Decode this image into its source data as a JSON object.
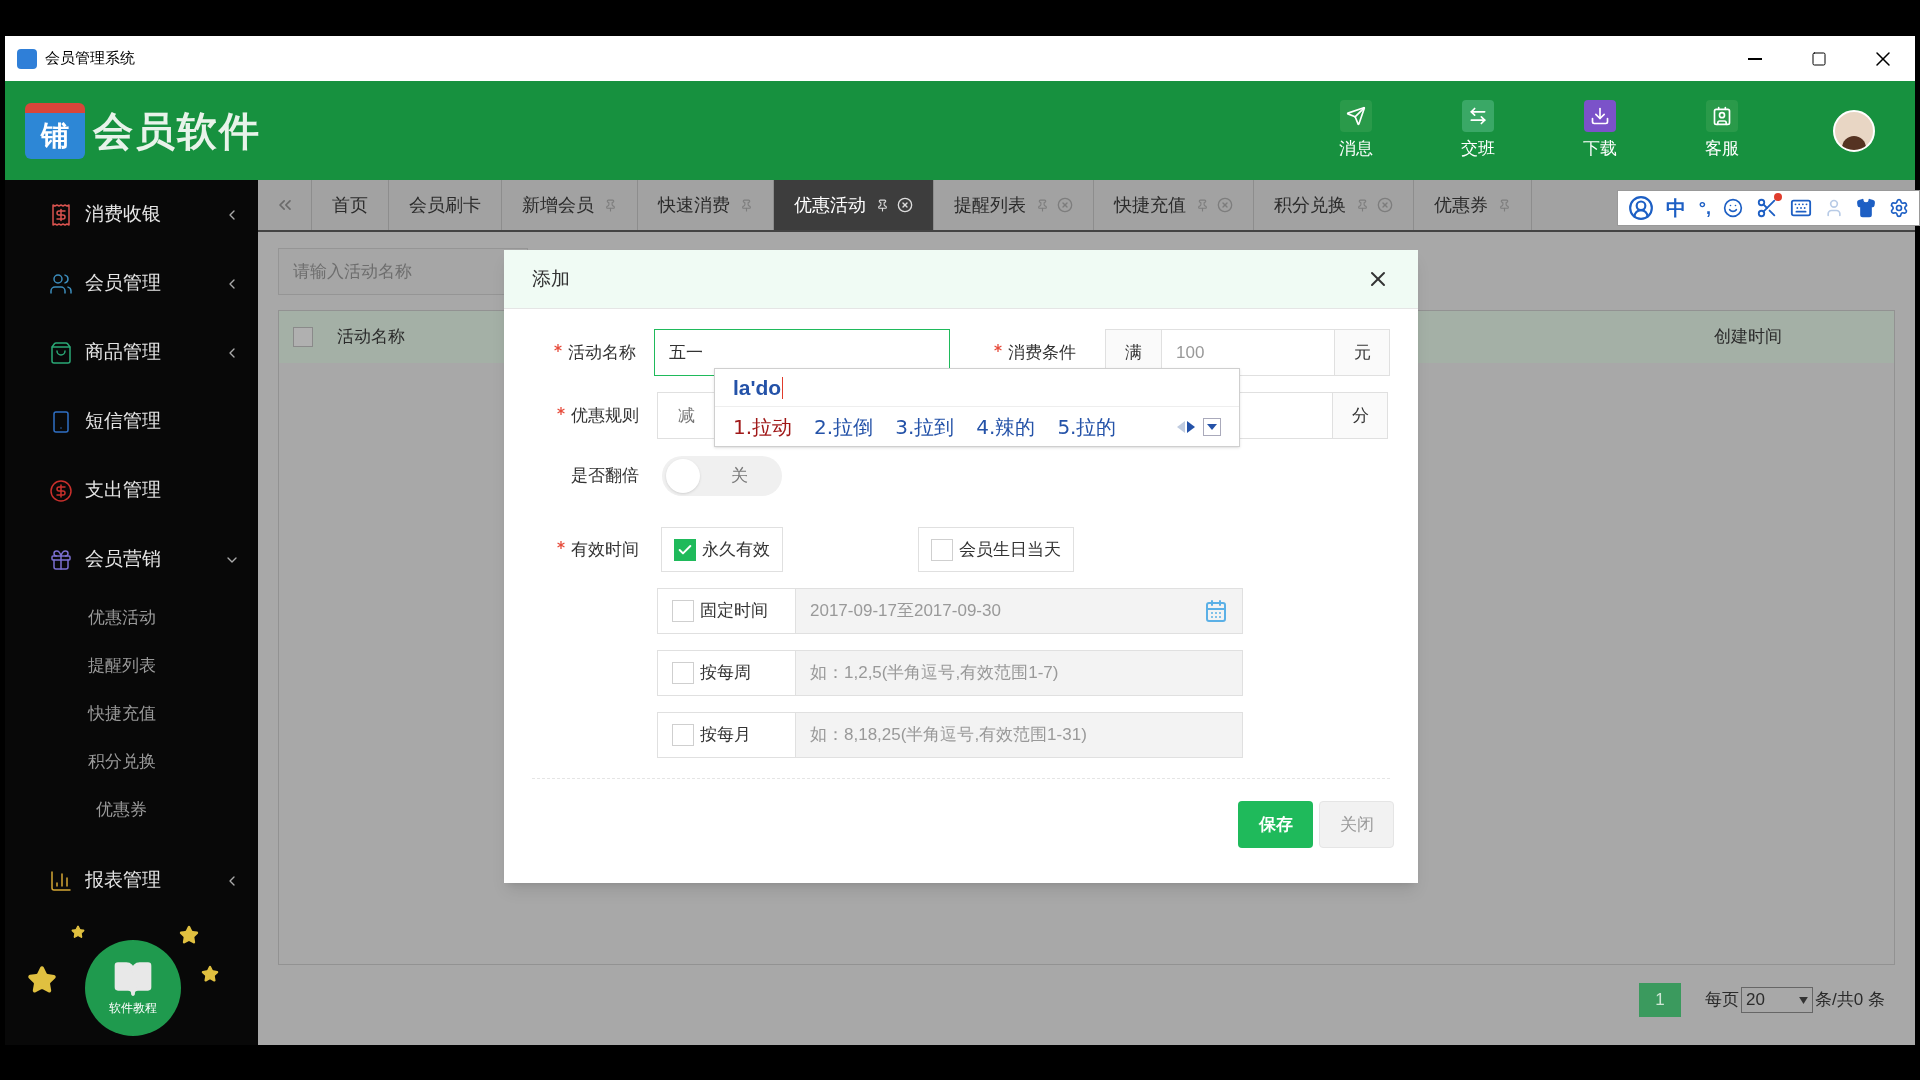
{
  "window": {
    "title": "会员管理系统"
  },
  "header": {
    "logo_badge": "铺",
    "logo_text": "会员软件",
    "actions": [
      {
        "label": "消息"
      },
      {
        "label": "交班"
      },
      {
        "label": "下载"
      },
      {
        "label": "客服"
      }
    ]
  },
  "sidebar": {
    "items": [
      {
        "label": "消费收银",
        "expanded": false
      },
      {
        "label": "会员管理",
        "expanded": false
      },
      {
        "label": "商品管理",
        "expanded": false
      },
      {
        "label": "短信管理"
      },
      {
        "label": "支出管理"
      },
      {
        "label": "会员营销",
        "expanded": true,
        "children": [
          {
            "label": "优惠活动"
          },
          {
            "label": "提醒列表"
          },
          {
            "label": "快捷充值"
          },
          {
            "label": "积分兑换"
          },
          {
            "label": "优惠券"
          }
        ]
      },
      {
        "label": "报表管理",
        "expanded": false
      }
    ],
    "tutorial": "软件教程"
  },
  "tabs": [
    {
      "label": "首页",
      "selected": false,
      "pinned": false,
      "closable": false
    },
    {
      "label": "会员刷卡",
      "selected": false,
      "pinned": false,
      "closable": false
    },
    {
      "label": "新增会员",
      "selected": false,
      "pinned": true,
      "closable": false
    },
    {
      "label": "快速消费",
      "selected": false,
      "pinned": true,
      "closable": false
    },
    {
      "label": "优惠活动",
      "selected": true,
      "pinned": true,
      "closable": true
    },
    {
      "label": "提醒列表",
      "selected": false,
      "pinned": true,
      "closable": true
    },
    {
      "label": "快捷充值",
      "selected": false,
      "pinned": true,
      "closable": true
    },
    {
      "label": "积分兑换",
      "selected": false,
      "pinned": true,
      "closable": true
    },
    {
      "label": "优惠券",
      "selected": false,
      "pinned": true,
      "closable": false
    }
  ],
  "search": {
    "placeholder": "请输入活动名称"
  },
  "table": {
    "select_all": {
      "checked": false
    },
    "columns": [
      "活动名称",
      "创建时间"
    ]
  },
  "pagination": {
    "pages": [
      {
        "label": "1",
        "selected": true
      }
    ],
    "per_page_label": "每页",
    "per_page": "20",
    "total": "条/共0 条"
  },
  "dialog": {
    "title": "添加",
    "name": {
      "label": "活动名称",
      "required": true,
      "value": "五一",
      "focused": true
    },
    "condition": {
      "label": "消费条件",
      "required": true,
      "prefix": "满",
      "placeholder": "100",
      "suffix": "元"
    },
    "rule": {
      "label": "优惠规则",
      "required": true,
      "placeholder": "减"
    },
    "rule_extra": {
      "suffix": "分"
    },
    "double": {
      "label": "是否翻倍",
      "on": false,
      "text": "关"
    },
    "validity": {
      "label": "有效时间",
      "required": true,
      "options": [
        {
          "label": "永久有效",
          "checked": true
        },
        {
          "label": "会员生日当天",
          "checked": false
        }
      ],
      "rows": [
        {
          "label": "固定时间",
          "checked": false,
          "placeholder": "2017-09-17至2017-09-30",
          "calendar": true
        },
        {
          "label": "按每周",
          "checked": false,
          "placeholder": "如：1,2,5(半角逗号,有效范围1-7)"
        },
        {
          "label": "按每月",
          "checked": false,
          "placeholder": "如：8,18,25(半角逗号,有效范围1-31)"
        }
      ]
    },
    "buttons": [
      {
        "label": "保存",
        "kind": "primary"
      },
      {
        "label": "关闭",
        "kind": "default"
      }
    ]
  },
  "ime": {
    "composition": "la'do",
    "candidates": [
      {
        "label": "1.拉动",
        "selected": true
      },
      {
        "label": "2.拉倒",
        "selected": false
      },
      {
        "label": "3.拉到",
        "selected": false
      },
      {
        "label": "4.辣的",
        "selected": false
      },
      {
        "label": "5.拉的",
        "selected": false
      }
    ]
  },
  "ime_toolbar": {
    "mode": "中",
    "punct": "°,"
  }
}
